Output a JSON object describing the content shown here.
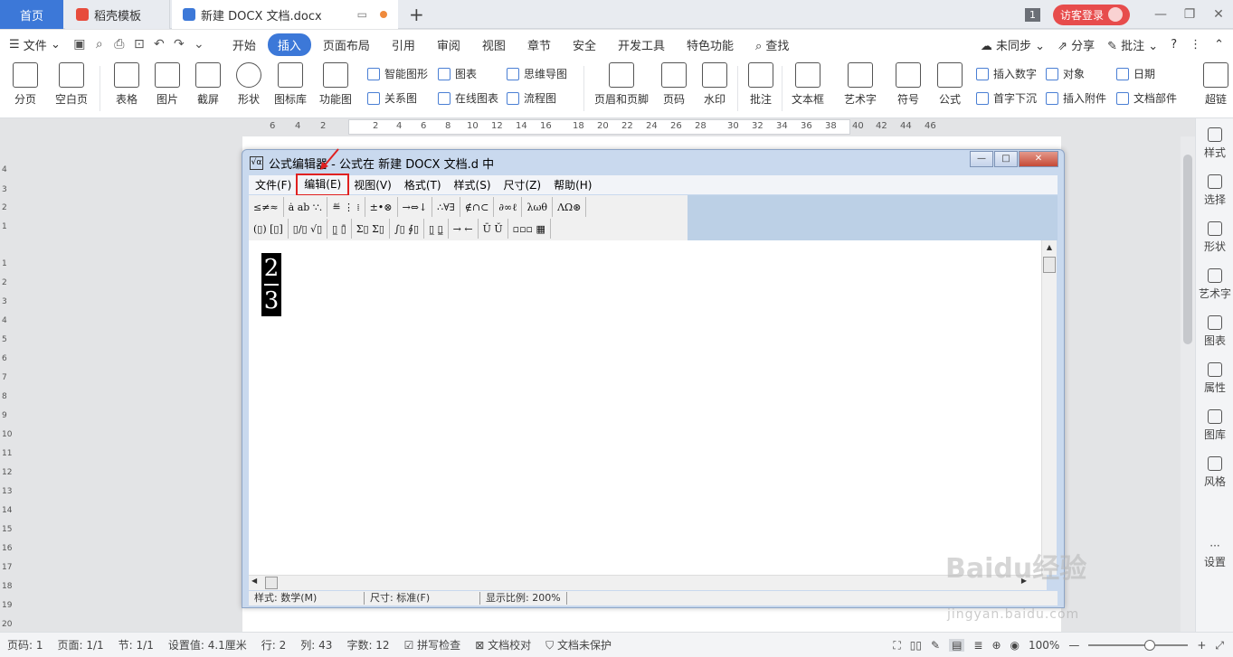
{
  "tabs": {
    "home": "首页",
    "template": "稻壳模板",
    "active_doc": "新建 DOCX 文档.docx",
    "new_tab": "+"
  },
  "titlebar": {
    "badge": "1",
    "login": "访客登录"
  },
  "menubar": {
    "file": "文件",
    "tabs": [
      "开始",
      "插入",
      "页面布局",
      "引用",
      "审阅",
      "视图",
      "章节",
      "安全",
      "开发工具",
      "特色功能"
    ],
    "active_tab": "插入",
    "search": "查找",
    "sync": "未同步",
    "share": "分享",
    "comment": "批注"
  },
  "ribbon": {
    "large": [
      "分页",
      "空白页",
      "表格",
      "图片",
      "截屏",
      "形状",
      "图标库",
      "功能图",
      "页眉和页脚",
      "页码",
      "水印",
      "批注",
      "文本框",
      "艺术字",
      "符号",
      "公式",
      "超链"
    ],
    "small": [
      "智能图形",
      "图表",
      "思维导图",
      "关系图",
      "在线图表",
      "流程图",
      "插入数字",
      "对象",
      "日期",
      "首字下沉",
      "插入附件",
      "文档部件"
    ]
  },
  "hruler_numbers": [
    "6",
    "4",
    "2",
    "2",
    "4",
    "6",
    "8",
    "10",
    "12",
    "14",
    "16",
    "18",
    "20",
    "22",
    "24",
    "26",
    "28",
    "30",
    "32",
    "34",
    "36",
    "38",
    "40",
    "42",
    "44",
    "46"
  ],
  "vruler_numbers": [
    "4",
    "3",
    "2",
    "1",
    "1",
    "2",
    "3",
    "4",
    "5",
    "6",
    "7",
    "8",
    "9",
    "10",
    "11",
    "12",
    "13",
    "14",
    "15",
    "16",
    "17",
    "18",
    "19",
    "20"
  ],
  "equation_editor": {
    "title": "公式编辑器 - 公式在 新建 DOCX 文档.d 中",
    "menus": [
      "文件(F)",
      "编辑(E)",
      "视图(V)",
      "格式(T)",
      "样式(S)",
      "尺寸(Z)",
      "帮助(H)"
    ],
    "highlighted_menu": "编辑(E)",
    "toolbar_row1": [
      "≤≠≈",
      "ȧ ab ∵.",
      "≝ ⋮ ⁞",
      "±•⊗",
      "→⇔↓",
      "∴∀∃",
      "∉∩⊂",
      "∂∞ℓ",
      "λωθ",
      "ΛΩ⊛"
    ],
    "toolbar_row2": [
      "(▯) [▯]",
      "▯/▯ √▯",
      "▯̲ ▯̄",
      "Σ▯ Σ▯",
      "∫▯ ∮▯",
      "▯̲ ▯̳",
      "→ ←",
      "Ū Ŭ",
      "▫▫▫ ▦"
    ],
    "formula": {
      "numerator": "2",
      "denominator": "3"
    },
    "status": {
      "style": "样式: 数学(M)",
      "size": "尺寸: 标准(F)",
      "zoom": "显示比例: 200%"
    }
  },
  "right_panel": [
    "样式",
    "选择",
    "形状",
    "艺术字",
    "图表",
    "属性",
    "图库",
    "风格",
    "设置"
  ],
  "statusbar": {
    "page_num": "页码: 1",
    "page": "页面: 1/1",
    "section": "节: 1/1",
    "setting": "设置值: 4.1厘米",
    "row": "行: 2",
    "col": "列: 43",
    "words": "字数: 12",
    "spell": "拼写检查",
    "proof": "文档校对",
    "protect": "文档未保护",
    "zoom": "100%"
  },
  "watermark": {
    "brand": "Baidu经验",
    "url": "jingyan.baidu.com"
  }
}
